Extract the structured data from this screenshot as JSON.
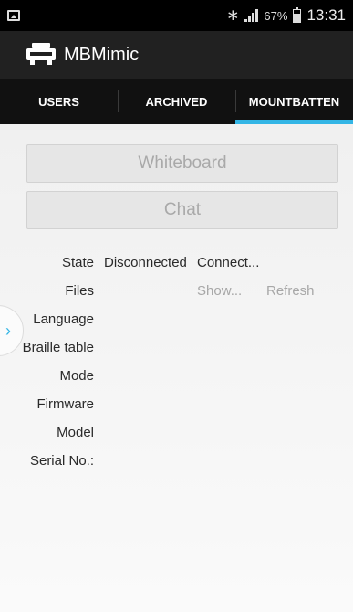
{
  "status_bar": {
    "battery": "67%",
    "time": "13:31"
  },
  "app_bar": {
    "title": "MBMimic"
  },
  "tabs": [
    {
      "label": "USERS",
      "active": false
    },
    {
      "label": "ARCHIVED",
      "active": false
    },
    {
      "label": "MOUNTBATTEN",
      "active": true
    }
  ],
  "buttons": {
    "whiteboard": "Whiteboard",
    "chat": "Chat"
  },
  "info": {
    "state": {
      "label": "State",
      "value": "Disconnected",
      "action": "Connect..."
    },
    "files": {
      "label": "Files",
      "action": "Show...",
      "action2": "Refresh"
    },
    "language": {
      "label": "Language"
    },
    "braille_table": {
      "label": "Braille table"
    },
    "mode": {
      "label": "Mode"
    },
    "firmware": {
      "label": "Firmware"
    },
    "model": {
      "label": "Model"
    },
    "serial": {
      "label": "Serial No.:"
    }
  },
  "colors": {
    "accent": "#33b5e5",
    "app_bar": "#212121",
    "tab_bar": "#111111"
  }
}
